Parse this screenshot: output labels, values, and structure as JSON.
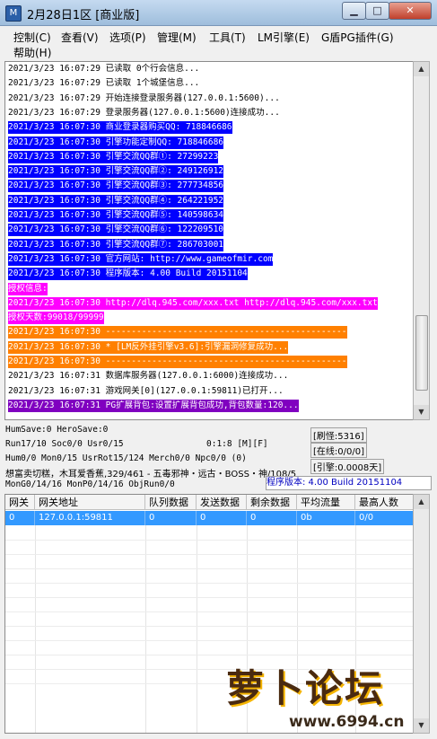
{
  "window": {
    "title": "2月28日1区 [商业版]",
    "icon": "app-icon",
    "min": "▁",
    "max": "□",
    "close": "✕"
  },
  "menu": [
    {
      "label": "控制(C)"
    },
    {
      "label": "查看(V)"
    },
    {
      "label": "选项(P)"
    },
    {
      "label": "管理(M)"
    },
    {
      "label": "工具(T)"
    },
    {
      "label": "LM引擎(E)"
    },
    {
      "label": "G盾PG插件(G)"
    },
    {
      "label": "帮助(H)"
    }
  ],
  "log": [
    {
      "text": "2021/3/23 16:07:29 已读取 0个行会信息...",
      "bg": "#ffffff",
      "fg": "#000000"
    },
    {
      "text": "2021/3/23 16:07:29 已读取 1个城堡信息...",
      "bg": "#ffffff",
      "fg": "#000000"
    },
    {
      "text": "2021/3/23 16:07:29 开始连接登录服务器(127.0.0.1:5600)...",
      "bg": "#ffffff",
      "fg": "#000000"
    },
    {
      "text": "2021/3/23 16:07:29 登录服务器(127.0.0.1:5600)连接成功...",
      "bg": "#ffffff",
      "fg": "#000000"
    },
    {
      "text": "2021/3/23 16:07:30 商业登录器购买QQ: 718846686",
      "bg": "#0000ff",
      "fg": "#ffffff"
    },
    {
      "text": "2021/3/23 16:07:30 引擎功能定制QQ: 718846686",
      "bg": "#0000ff",
      "fg": "#ffffff"
    },
    {
      "text": "2021/3/23 16:07:30 引擎交流QQ群①: 27299223",
      "bg": "#0000ff",
      "fg": "#ffffff"
    },
    {
      "text": "2021/3/23 16:07:30 引擎交流QQ群②: 249126912",
      "bg": "#0000ff",
      "fg": "#ffffff"
    },
    {
      "text": "2021/3/23 16:07:30 引擎交流QQ群③: 277734856",
      "bg": "#0000ff",
      "fg": "#ffffff"
    },
    {
      "text": "2021/3/23 16:07:30 引擎交流QQ群④: 264221952",
      "bg": "#0000ff",
      "fg": "#ffffff"
    },
    {
      "text": "2021/3/23 16:07:30 引擎交流QQ群⑤: 140598634",
      "bg": "#0000ff",
      "fg": "#ffffff"
    },
    {
      "text": "2021/3/23 16:07:30 引擎交流QQ群⑥: 122209510",
      "bg": "#0000ff",
      "fg": "#ffffff"
    },
    {
      "text": "2021/3/23 16:07:30 引擎交流QQ群⑦: 286703001",
      "bg": "#0000ff",
      "fg": "#ffffff"
    },
    {
      "text": "2021/3/23 16:07:30 官方网站: http://www.gameofmir.com",
      "bg": "#0000ff",
      "fg": "#ffffff"
    },
    {
      "text": "2021/3/23 16:07:30 程序版本: 4.00 Build 20151104",
      "bg": "#0000ff",
      "fg": "#ffffff"
    },
    {
      "text": "授权信息:",
      "bg": "#ff00ff",
      "fg": "#ffffff"
    },
    {
      "text": "2021/3/23 16:07:30 http://dlq.945.com/xxx.txt http://dlq.945.com/xxx.txt",
      "bg": "#ff00ff",
      "fg": "#ffffff"
    },
    {
      "text": "授权天数:99018/99999",
      "bg": "#ff00ff",
      "fg": "#ffffff"
    },
    {
      "text": "2021/3/23 16:07:30 -----------------------------------------------",
      "bg": "#ff8000",
      "fg": "#ffffff"
    },
    {
      "text": "2021/3/23 16:07:30 * [LM反外挂引擎v3.6]:引擎漏洞修复成功...",
      "bg": "#ff8000",
      "fg": "#ffffff"
    },
    {
      "text": "2021/3/23 16:07:30 -----------------------------------------------",
      "bg": "#ff8000",
      "fg": "#ffffff"
    },
    {
      "text": "2021/3/23 16:07:31 数据库服务器(127.0.0.1:6000)连接成功...",
      "bg": "#ffffff",
      "fg": "#000000"
    },
    {
      "text": "2021/3/23 16:07:31 游戏网关[0](127.0.0.1:59811)已打开...",
      "bg": "#ffffff",
      "fg": "#000000"
    },
    {
      "text": "2021/3/23 16:07:31 PG扩展背包:设置扩展背包成功,背包数量:120...",
      "bg": "#8000c0",
      "fg": "#ffffff"
    }
  ],
  "stats": {
    "line1": "HumSave:0 HeroSave:0",
    "line2": "Run17/10 Soc0/0 Usr0/15",
    "line2b": "0:1:8 [M][F]",
    "line3": "Hum0/0 Mon0/15 UsrRot15/124 Merch0/0 Npc0/0 (0)",
    "line4": "想富卖切糕，木耳爱香蕉,329/461 - 五毒邪神・远古・BOSS・神/108/5",
    "line5": "MonG0/14/16 MonP0/14/16 ObjRun0/0",
    "refresh": "[刷怪:5316]",
    "online": "[在线:0/0/0]",
    "engine": "[引擎:0.0008天]",
    "version": "程序版本: 4.00 Build 20151104"
  },
  "table": {
    "headers": [
      "网关",
      "网关地址",
      "队列数据",
      "发送数据",
      "剩余数据",
      "平均流量",
      "最高人数"
    ],
    "rows": [
      [
        "0",
        "127.0.0.1:59811",
        "0",
        "0",
        "0",
        "0b",
        "0/0"
      ]
    ]
  },
  "watermark": {
    "main": "萝卜论坛",
    "sub": "www.6994.cn"
  },
  "colors": {
    "selection": "#3399ff",
    "log_blue": "#0000ff",
    "log_magenta": "#ff00ff",
    "log_orange": "#ff8000",
    "log_purple": "#8000c0"
  }
}
